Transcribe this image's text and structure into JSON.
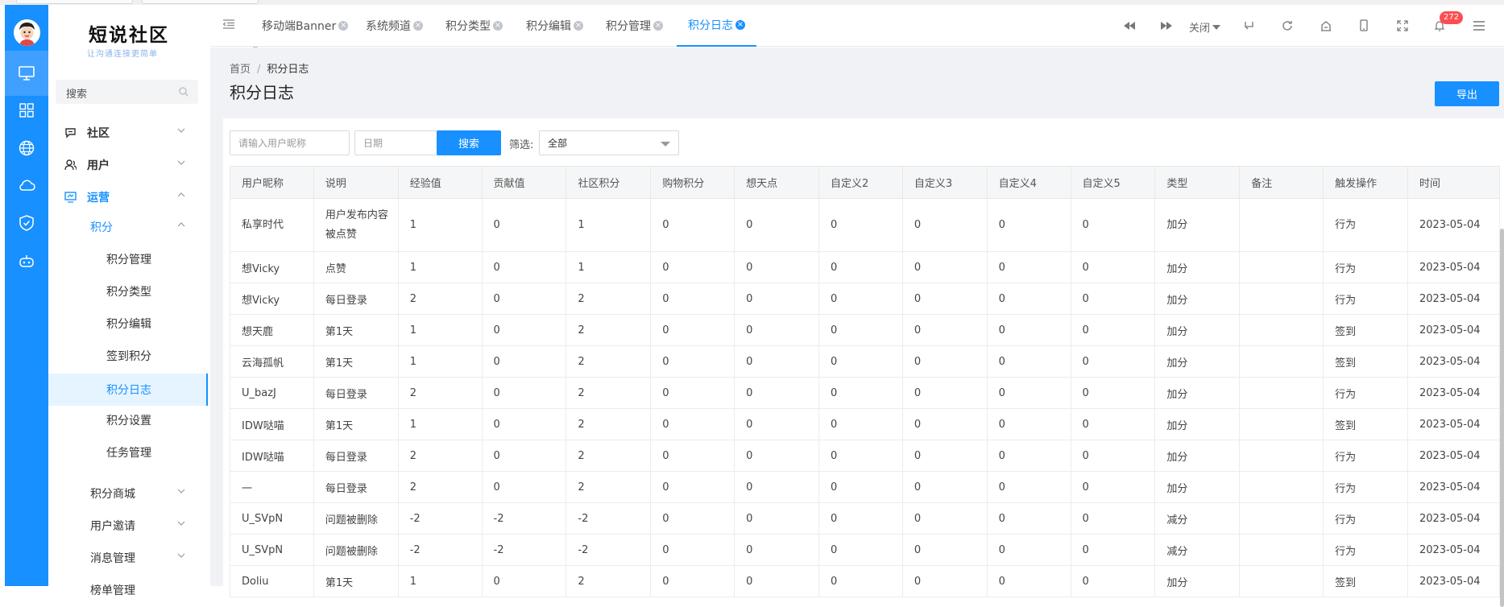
{
  "colors": {
    "primary": "#1890ff",
    "rail_active": "#40a0ff",
    "badge": "#ff4d4f"
  },
  "rail": {
    "items": [
      {
        "icon": "monitor-icon",
        "active": true
      },
      {
        "icon": "grid-icon",
        "active": false
      },
      {
        "icon": "globe-icon",
        "active": false
      },
      {
        "icon": "cloud-icon",
        "active": false
      },
      {
        "icon": "shield-check-icon",
        "active": false
      },
      {
        "icon": "robot-icon",
        "active": false
      }
    ]
  },
  "brand": {
    "title": "短说社区",
    "subtitle": "让沟通连接更简单"
  },
  "sidebar": {
    "search_label": "搜索",
    "items": [
      {
        "label": "社区",
        "icon": "chat-icon"
      },
      {
        "label": "用户",
        "icon": "users-icon"
      },
      {
        "label": "运营",
        "icon": "monitor-chart-icon"
      },
      {
        "label": "积分"
      },
      {
        "label": "积分管理"
      },
      {
        "label": "积分类型"
      },
      {
        "label": "积分编辑"
      },
      {
        "label": "签到积分"
      },
      {
        "label": "积分日志"
      },
      {
        "label": "积分设置"
      },
      {
        "label": "任务管理"
      },
      {
        "label": "积分商城"
      },
      {
        "label": "用户邀请"
      },
      {
        "label": "消息管理"
      },
      {
        "label": "榜单管理"
      }
    ]
  },
  "tabs": [
    {
      "label": "移动端Banner"
    },
    {
      "label": "系统频道"
    },
    {
      "label": "积分类型"
    },
    {
      "label": "积分编辑"
    },
    {
      "label": "积分管理"
    },
    {
      "label": "积分日志"
    }
  ],
  "toolbar": {
    "close_label": "关闭",
    "notification_count": "272"
  },
  "breadcrumb": {
    "home": "首页",
    "separator": "/",
    "current": "积分日志"
  },
  "page": {
    "title": "积分日志",
    "export_label": "导出"
  },
  "filters": {
    "nickname_placeholder": "请输入用户昵称",
    "date_placeholder": "日期",
    "search_label": "搜索",
    "filter_label": "筛选:",
    "filter_value": "全部"
  },
  "table": {
    "columns": [
      "用户昵称",
      "说明",
      "经验值",
      "贡献值",
      "社区积分",
      "购物积分",
      "想天点",
      "自定义2",
      "自定义3",
      "自定义4",
      "自定义5",
      "类型",
      "备注",
      "触发操作",
      "时间"
    ],
    "rows": [
      [
        "私享时代",
        "用户发布内容被点赞",
        "1",
        "0",
        "1",
        "0",
        "0",
        "0",
        "0",
        "0",
        "0",
        "加分",
        "",
        "行为",
        "2023-05-04"
      ],
      [
        "想Vicky",
        "点赞",
        "1",
        "0",
        "1",
        "0",
        "0",
        "0",
        "0",
        "0",
        "0",
        "加分",
        "",
        "行为",
        "2023-05-04"
      ],
      [
        "想Vicky",
        "每日登录",
        "2",
        "0",
        "2",
        "0",
        "0",
        "0",
        "0",
        "0",
        "0",
        "加分",
        "",
        "行为",
        "2023-05-04"
      ],
      [
        "想天鹿",
        "第1天",
        "1",
        "0",
        "2",
        "0",
        "0",
        "0",
        "0",
        "0",
        "0",
        "加分",
        "",
        "签到",
        "2023-05-04"
      ],
      [
        "云海孤帆",
        "第1天",
        "1",
        "0",
        "2",
        "0",
        "0",
        "0",
        "0",
        "0",
        "0",
        "加分",
        "",
        "签到",
        "2023-05-04"
      ],
      [
        "U_bazJ",
        "每日登录",
        "2",
        "0",
        "2",
        "0",
        "0",
        "0",
        "0",
        "0",
        "0",
        "加分",
        "",
        "行为",
        "2023-05-04"
      ],
      [
        "IDW哒喵",
        "第1天",
        "1",
        "0",
        "2",
        "0",
        "0",
        "0",
        "0",
        "0",
        "0",
        "加分",
        "",
        "签到",
        "2023-05-04"
      ],
      [
        "IDW哒喵",
        "每日登录",
        "2",
        "0",
        "2",
        "0",
        "0",
        "0",
        "0",
        "0",
        "0",
        "加分",
        "",
        "行为",
        "2023-05-04"
      ],
      [
        "一",
        "每日登录",
        "2",
        "0",
        "2",
        "0",
        "0",
        "0",
        "0",
        "0",
        "0",
        "加分",
        "",
        "行为",
        "2023-05-04"
      ],
      [
        "U_SVpN",
        "问题被删除",
        "-2",
        "-2",
        "-2",
        "0",
        "0",
        "0",
        "0",
        "0",
        "0",
        "减分",
        "",
        "行为",
        "2023-05-04"
      ],
      [
        "U_SVpN",
        "问题被删除",
        "-2",
        "-2",
        "-2",
        "0",
        "0",
        "0",
        "0",
        "0",
        "0",
        "减分",
        "",
        "行为",
        "2023-05-04"
      ],
      [
        "Doliu",
        "第1天",
        "1",
        "0",
        "2",
        "0",
        "0",
        "0",
        "0",
        "0",
        "0",
        "加分",
        "",
        "签到",
        "2023-05-04"
      ]
    ]
  }
}
